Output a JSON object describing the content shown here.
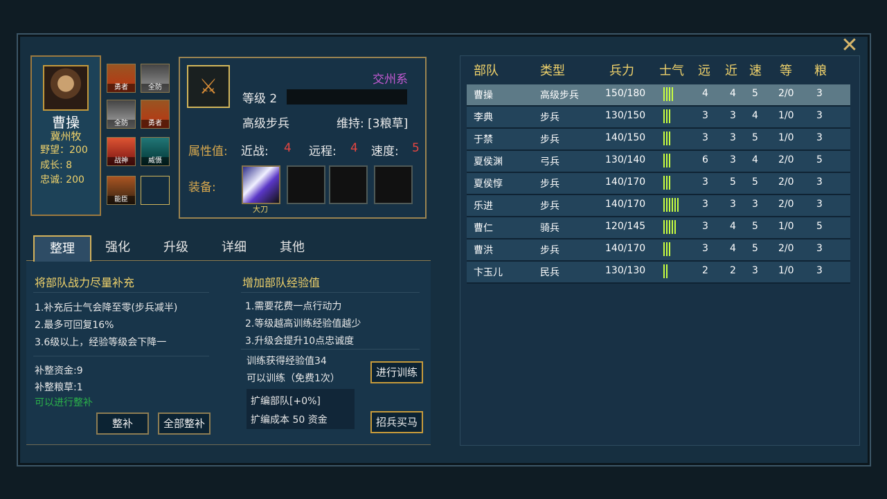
{
  "close_icon_label": "✕",
  "hero": {
    "name": "曹操",
    "title": "冀州牧",
    "ambition": "野望：200",
    "growth": "成长: 8",
    "loyalty": "忠诚: 200"
  },
  "skills": [
    {
      "label": "勇者"
    },
    {
      "label": "全防"
    },
    {
      "label": "全防"
    },
    {
      "label": "勇者"
    },
    {
      "label": "战神"
    },
    {
      "label": "威慑"
    },
    {
      "label": "能臣"
    },
    {
      "label": ""
    }
  ],
  "unit": {
    "faction": "交州系",
    "level": "等级 2",
    "type": "高级步兵",
    "maintain": "维持: [3粮草]",
    "attribute_label": "属性值:",
    "melee_label": "近战:",
    "melee": "4",
    "ranged_label": "远程:",
    "ranged": "4",
    "speed_label": "速度:",
    "speed": "5",
    "equip_label": "装备:",
    "weapon_name": "大刀"
  },
  "tabs": [
    "整理",
    "强化",
    "升级",
    "详细",
    "其他"
  ],
  "content": {
    "left_title": "将部队战力尽量补充",
    "left_lines": [
      "1.补充后士气会降至零(步兵减半)",
      "2.最多可回复16%",
      "3.6级以上，经验等级会下降一"
    ],
    "supply_money": "补整资金:9",
    "supply_food": "补整粮草:1",
    "can_supply": "可以进行整补",
    "btn_supply": "整补",
    "btn_supply_all": "全部整补",
    "right_title": "增加部队经验值",
    "right_lines": [
      "1.需要花费一点行动力",
      "2.等级越高训练经验值越少",
      "3.升级会提升10点忠诚度"
    ],
    "train_exp": "训练获得经验值34",
    "train_status": "可以训练（免费1次）",
    "btn_train": "进行训练",
    "expand": "扩编部队[+0%]",
    "expand_cost": "扩编成本 50 资金",
    "btn_recruit": "招兵买马"
  },
  "table": {
    "headers": [
      "部队",
      "类型",
      "兵力",
      "士气",
      "远",
      "近",
      "速",
      "等",
      "粮"
    ],
    "rows": [
      {
        "name": "曹操",
        "type": "高级步兵",
        "troops": "150/180",
        "morale": 4,
        "far": "4",
        "near": "4",
        "speed": "5",
        "level": "2/0",
        "food": "3",
        "selected": true
      },
      {
        "name": "李典",
        "type": "步兵",
        "troops": "130/150",
        "morale": 3,
        "far": "3",
        "near": "3",
        "speed": "4",
        "level": "1/0",
        "food": "3"
      },
      {
        "name": "于禁",
        "type": "步兵",
        "troops": "140/150",
        "morale": 3,
        "far": "3",
        "near": "3",
        "speed": "5",
        "level": "1/0",
        "food": "3"
      },
      {
        "name": "夏侯渊",
        "type": "弓兵",
        "troops": "130/140",
        "morale": 3,
        "far": "6",
        "near": "3",
        "speed": "4",
        "level": "2/0",
        "food": "5"
      },
      {
        "name": "夏侯惇",
        "type": "步兵",
        "troops": "140/170",
        "morale": 3,
        "far": "3",
        "near": "5",
        "speed": "5",
        "level": "2/0",
        "food": "3"
      },
      {
        "name": "乐进",
        "type": "步兵",
        "troops": "140/170",
        "morale": 6,
        "far": "3",
        "near": "3",
        "speed": "3",
        "level": "2/0",
        "food": "3"
      },
      {
        "name": "曹仁",
        "type": "骑兵",
        "troops": "120/145",
        "morale": 5,
        "far": "3",
        "near": "4",
        "speed": "5",
        "level": "1/0",
        "food": "5"
      },
      {
        "name": "曹洪",
        "type": "步兵",
        "troops": "140/170",
        "morale": 3,
        "far": "3",
        "near": "4",
        "speed": "5",
        "level": "2/0",
        "food": "3"
      },
      {
        "name": "卞玉儿",
        "type": "民兵",
        "troops": "130/130",
        "morale": 2,
        "far": "2",
        "near": "2",
        "speed": "3",
        "level": "1/0",
        "food": "3"
      }
    ]
  }
}
